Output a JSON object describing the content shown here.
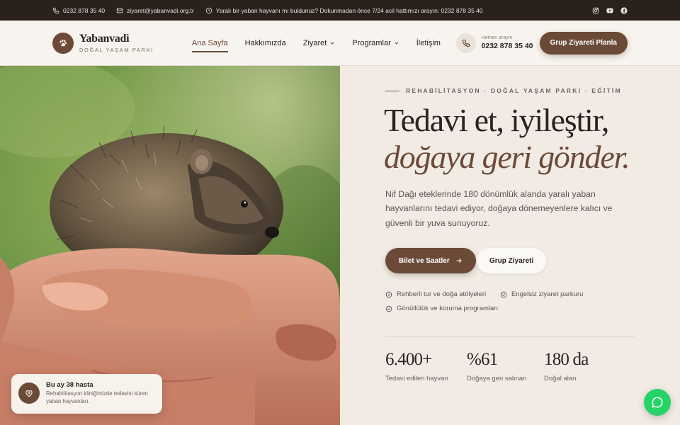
{
  "topbar": {
    "phone": "0232 878 35 40",
    "email": "ziyaret@yabanvadi.org.tr",
    "alert": "Yaralı bir yaban hayvanı mı buldunuz? Dokunmadan önce 7/24 acil hattımızı arayın: 0232 878 35 40",
    "social": [
      "instagram-icon",
      "youtube-icon",
      "facebook-icon"
    ]
  },
  "header": {
    "brand_name": "Yabanvadi",
    "brand_tagline": "DOĞAL YAŞAM PARKI",
    "nav": [
      {
        "label": "Ana Sayfa",
        "active": true
      },
      {
        "label": "Hakkımızda"
      },
      {
        "label": "Ziyaret",
        "dropdown": true
      },
      {
        "label": "Programlar",
        "dropdown": true
      },
      {
        "label": "İletişim"
      }
    ],
    "phone_caption": "Hemen arayın",
    "phone_number": "0232 878 35 40",
    "cta": "Grup Ziyareti Planla"
  },
  "toast": {
    "title": "Bu ay 38 hasta",
    "text": "Rehabilitasyon kliniğimizde tedavisi süren yaban hayvanları."
  },
  "hero": {
    "eyebrow": "REHABİLİTASYON · DOĞAL YAŞAM PARKI · EĞİTİM",
    "headline_1": "Tedavi et, iyileştir,",
    "headline_2": "doğaya geri gönder.",
    "lead": "Nif Dağı eteklerinde 180 dönümlük alanda yaralı yaban hayvanlarını tedavi ediyor, doğaya dönemeyenlere kalıcı ve güvenli bir yuva sunuyoruz.",
    "primary_button": "Bilet ve Saatler",
    "secondary_button": "Grup Ziyareti",
    "features": [
      "Rehberli tur ve doğa atölyeleri",
      "Engelsiz ziyaret parkuru",
      "Gönüllülük ve koruma programları"
    ],
    "stats": [
      {
        "value": "6.400+",
        "label": "Tedavi edilen hayvan"
      },
      {
        "value": "%61",
        "label": "Doğaya geri salınan"
      },
      {
        "value": "180 da",
        "label": "Doğal alan"
      }
    ]
  },
  "colors": {
    "brand": "#6b4b38",
    "topbar": "#2b211c",
    "whatsapp": "#25d366"
  }
}
